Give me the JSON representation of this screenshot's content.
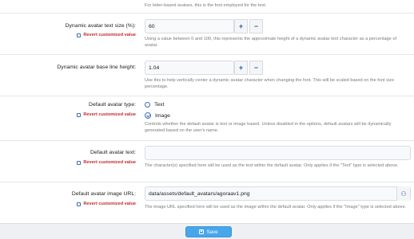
{
  "top_hint": "For letter-based avatars, this is the font employed for the text.",
  "fields": [
    {
      "label": "Dynamic avatar text size (%):",
      "revert": "Revert customized value",
      "value": "60",
      "hint": "Using a value between 0 and 100, this represents the approximate height of a dynamic avatar text character as a percentage of avatar."
    },
    {
      "label": "Dynamic avatar base line height:",
      "value": "1.04",
      "hint": "Use this to help vertically center a dynamic avatar character when changing the font. This will be scaled based on the font size percentage."
    },
    {
      "label": "Default avatar type:",
      "revert": "Revert customized value",
      "options": [
        "Text",
        "Image"
      ],
      "selected": "Image",
      "hint": "Controls whether the default avatar is text or image based. Unless disabled in the options, default avatars will be dynamically generated based on the user's name."
    },
    {
      "label": "Default avatar text:",
      "revert": "Revert customized value",
      "value": "",
      "hint": "The character(s) specified here will be used as the text within the default avatar. Only applies if the \"Text\" type is selected above."
    },
    {
      "label": "Default avatar image URL:",
      "revert": "Revert customized value",
      "value": "data/assets/default_avatars/agoraav1.png",
      "hint": "The image URL specified here will be used as the image within the default avatar. Only applies if the \"Image\" type is selected above."
    }
  ],
  "stepper": {
    "plus": "+",
    "minus": "−"
  },
  "save_label": "Save",
  "icons": {
    "revert": "checkbox-icon",
    "save": "save-icon",
    "browse": "edit-image-icon"
  }
}
